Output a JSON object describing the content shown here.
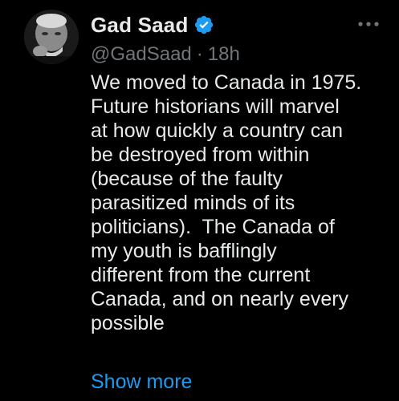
{
  "tweet": {
    "author": {
      "display_name": "Gad Saad",
      "handle": "@GadSaad",
      "verified": true,
      "verified_color": "#1d9bf0"
    },
    "separator": "·",
    "timestamp": "18h",
    "lines": [
      "We moved to Canada in 1975.",
      "Future historians will marvel",
      "at how quickly a country can",
      "be destroyed from within",
      "(because of the faulty",
      "parasitized minds of its",
      "politicians).  The Canada of",
      "my youth is bafflingly",
      "different from the current",
      "Canada, and on nearly every",
      "possible"
    ],
    "show_more_label": "Show more",
    "more_menu_icon": "ellipsis-icon"
  },
  "colors": {
    "background": "#000000",
    "text": "#e7e9ea",
    "secondary_text": "#71767b",
    "link": "#1d9bf0"
  }
}
